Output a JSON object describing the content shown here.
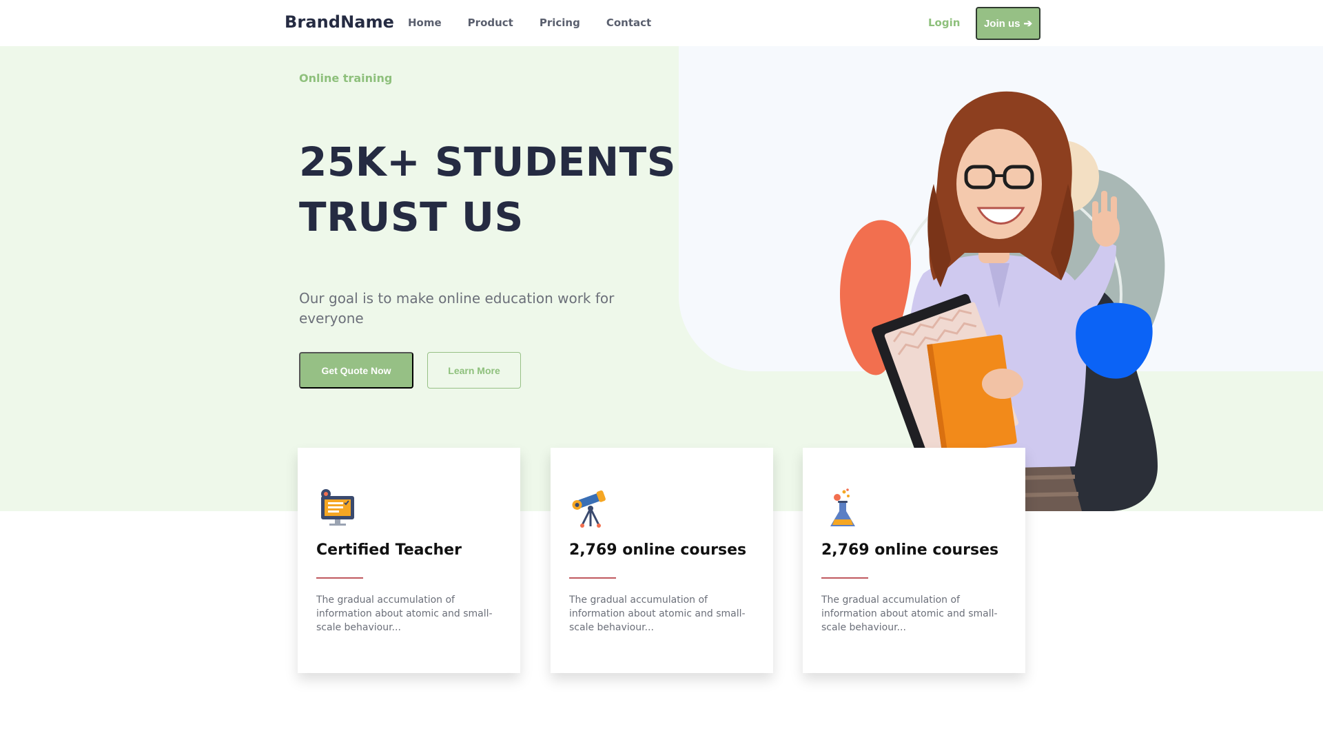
{
  "navbar": {
    "brand": "BrandName",
    "links": [
      "Home",
      "Product",
      "Pricing",
      "Contact"
    ],
    "login": "Login",
    "join": "Join us",
    "join_icon": "arrow-right-icon"
  },
  "hero": {
    "tagline": "Online training",
    "headline": "25K+ STUDENTS TRUST US",
    "subtitle": "Our goal is to make online education work for everyone",
    "primary_button": "Get Quote Now",
    "secondary_button": "Learn More"
  },
  "cards": [
    {
      "icon": "monitor-checklist-icon",
      "title": "Certified Teacher",
      "text": "The gradual accumulation of information about atomic and small-scale behaviour..."
    },
    {
      "icon": "telescope-icon",
      "title": "2,769 online courses",
      "text": "The gradual accumulation of information about atomic and small-scale behaviour..."
    },
    {
      "icon": "flask-icon",
      "title": "2,769 online courses",
      "text": "The gradual accumulation of information about atomic and small-scale behaviour..."
    }
  ],
  "colors": {
    "accent": "#96c085",
    "heading": "#252B42",
    "hero_bg": "#eef8ea",
    "divider": "#c0585e"
  }
}
